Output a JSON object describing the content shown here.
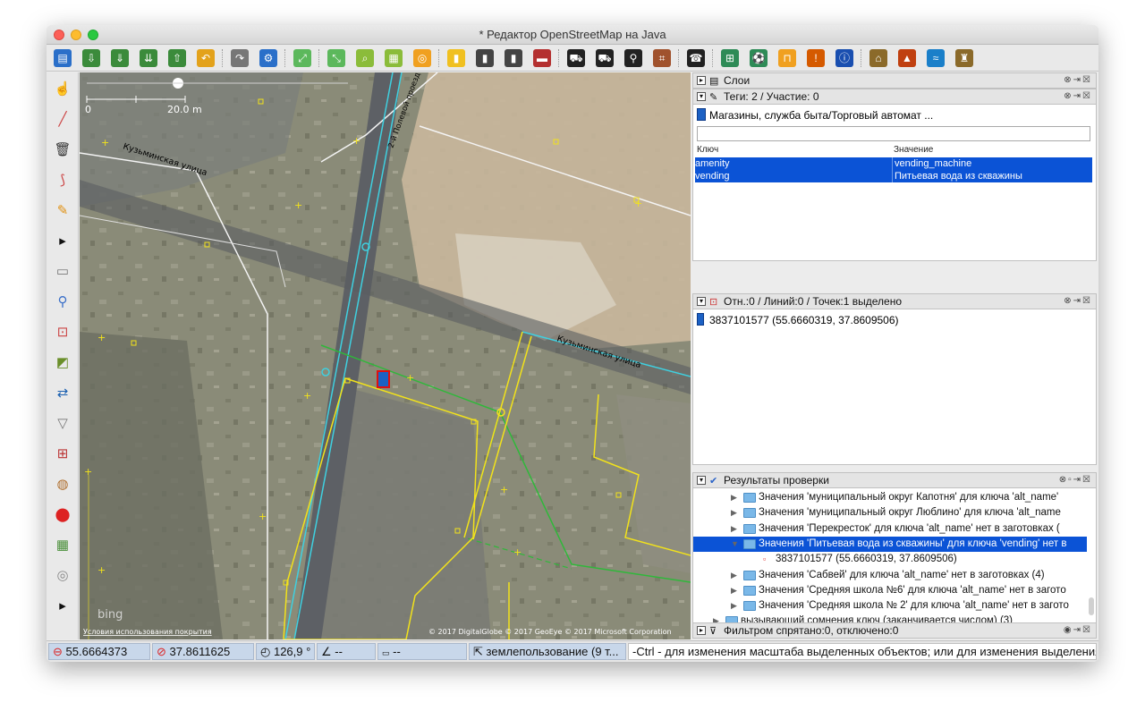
{
  "window": {
    "title": "* Редактор OpenStreetMap на Java"
  },
  "colors": {
    "selection": "#0b53d6",
    "status_bg": "#c8d7ea",
    "map_way_yellow": "#f2e21b",
    "map_way_cyan": "#3fd0e0",
    "map_way_green": "#2fb83a"
  },
  "toolbar": {
    "icons": [
      "new-icon",
      "open-icon",
      "download-icon",
      "download-more-icon",
      "upload-icon",
      "undo-icon",
      "redo-icon",
      "preferences-icon",
      "zoom-all-icon",
      "zoom-selection-icon",
      "search-icon",
      "wms-icon",
      "overpass-icon",
      "traffic-light-icon",
      "barrier-icon",
      "crossing-icon",
      "wall-icon",
      "car-icon",
      "bus-icon",
      "bicycle-icon",
      "railway-icon",
      "phone-icon",
      "boundary-icon",
      "sport-icon",
      "shop-icon",
      "warning-icon",
      "info-icon",
      "industrial-icon",
      "peak-icon",
      "river-icon",
      "castle-icon"
    ]
  },
  "left_toolbar": {
    "icons": [
      "select-icon",
      "draw-icon",
      "delete-icon",
      "lasso-icon",
      "pencil-icon",
      "more-icon",
      "layers-icon",
      "tags-icon",
      "relations-icon",
      "presets-icon",
      "swap-icon",
      "filter-icon",
      "gift-icon",
      "palette-icon",
      "marker-icon",
      "chart-icon",
      "globe-icon",
      "more-icon"
    ]
  },
  "map": {
    "scale_label": "20.0 m",
    "scale_zero": "0",
    "street_label_1": "Кузьминская улица",
    "street_label_2": "Кузьминская улица",
    "street_label_3": "2-й Полевой проезд",
    "bing_label": "bing",
    "terms_link": "Условия использования покрытия",
    "attribution": "© 2017 DigitalGlobe © 2017 GeoEye © 2017 Microsoft Corporation"
  },
  "layers_panel": {
    "title": "Слои"
  },
  "tags_panel": {
    "title": "Теги: 2 / Участие: 0",
    "preset": "Магазины, служба быта/Торговый автомат ...",
    "col_key": "Ключ",
    "col_value": "Значение",
    "rows": [
      {
        "key": "amenity",
        "value": "vending_machine"
      },
      {
        "key": "vending",
        "value": "Питьевая вода из скважины"
      }
    ]
  },
  "selection_panel": {
    "title": "Отн.:0 / Линий:0 / Точек:1 выделено",
    "item": "3837101577 (55.6660319, 37.8609506)"
  },
  "validation_panel": {
    "title": "Результаты проверки",
    "rows": [
      {
        "text": "Значения 'муниципальный округ Капотня' для ключа 'alt_name'",
        "expanded": false,
        "selected": false
      },
      {
        "text": "Значения 'муниципальный округ Люблино' для ключа 'alt_name",
        "expanded": false,
        "selected": false
      },
      {
        "text": "Значения 'Перекресток' для ключа 'alt_name' нет в заготовках (",
        "expanded": false,
        "selected": false
      },
      {
        "text": "Значения 'Питьевая вода из скважины' для ключа 'vending' нет в",
        "expanded": true,
        "selected": true
      },
      {
        "text": "3837101577 (55.6660319, 37.8609506)",
        "child": true
      },
      {
        "text": "Значения 'Сабвей' для ключа 'alt_name' нет в заготовках (4)",
        "expanded": false,
        "selected": false
      },
      {
        "text": "Значения 'Средняя школа №6' для ключа 'alt_name' нет в загото",
        "expanded": false,
        "selected": false
      },
      {
        "text": "Значения 'Средняя школа № 2' для ключа 'alt_name' нет в загото",
        "expanded": false,
        "selected": false
      },
      {
        "text": "вызывающий сомнения ключ (заканчивается числом) (3)",
        "expanded": false,
        "selected": false,
        "top": true
      }
    ]
  },
  "filter_panel": {
    "title": "Фильтром спрятано:0, отключено:0"
  },
  "statusbar": {
    "lat": "55.6664373",
    "lon": "37.8611625",
    "heading": "126,9 °",
    "angle": "--",
    "distance": "--",
    "landuse": "землепользование (9 т...",
    "help": "-Ctrl - для изменения масштаба выделенных объектов; или для изменения выделения"
  }
}
